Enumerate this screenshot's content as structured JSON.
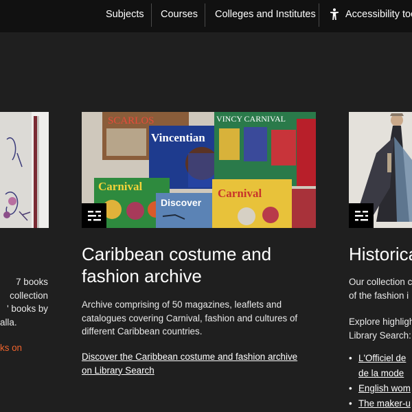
{
  "nav": {
    "items": [
      "Subjects",
      "Courses",
      "Colleges and Institutes"
    ],
    "accessibility_label": "Accessibility tools"
  },
  "cards": [
    {
      "text_lines": [
        "7 books",
        "collection",
        "' books by",
        "alla."
      ],
      "link_text": "ks on"
    },
    {
      "title_lines": [
        "Caribbean costume and",
        "fashion archive"
      ],
      "text_lines": [
        "Archive comprising of 50 magazines, leaflets and",
        "catalogues covering Carnival, fashion and cultures of",
        "different Caribbean countries."
      ],
      "link_lines": [
        "Discover the Caribbean costume and fashion archive",
        "on Library Search"
      ],
      "image_labels": {
        "a": "SCARLOS",
        "b": "Vincentian",
        "c": "VINCY CARNIVAL",
        "d": "Carnival",
        "e": "Discover",
        "f": "Carnival"
      }
    },
    {
      "title": "Historica",
      "text_lines": [
        "Our collection c",
        "of the fashion i"
      ],
      "explore_lines": [
        "Explore highligh",
        "Library Search:"
      ],
      "list": [
        [
          "L'Officiel de",
          "de la mode"
        ],
        [
          "English wom"
        ],
        [
          "The maker-u"
        ]
      ]
    }
  ],
  "colors": {
    "background": "#1f1f1f",
    "topbar": "#111111",
    "accent_link": "#f0642d"
  }
}
